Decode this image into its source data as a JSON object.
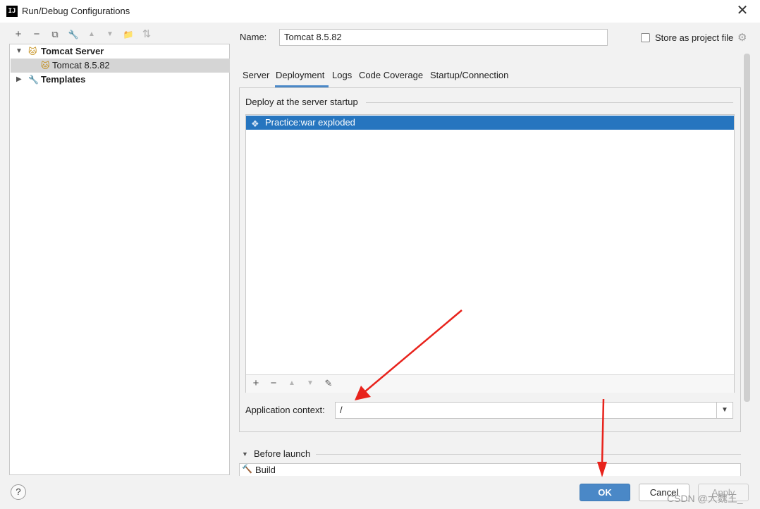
{
  "window": {
    "title": "Run/Debug Configurations",
    "app_icon_text": "IJ",
    "close_glyph": "✕"
  },
  "toolbar": {
    "add": "+",
    "remove": "−",
    "copy": "⧉",
    "edit_templates": "🔧",
    "move_up": "▲",
    "move_down": "▼",
    "new_folder": "📁",
    "sort": "⇅"
  },
  "tree": {
    "group_label": "Tomcat Server",
    "child_label": "Tomcat 8.5.82",
    "templates_label": "Templates"
  },
  "form": {
    "name_label": "Name:",
    "name_value": "Tomcat 8.5.82",
    "store_label": "Store as project file"
  },
  "tabs": [
    "Server",
    "Deployment",
    "Logs",
    "Code Coverage",
    "Startup/Connection"
  ],
  "active_tab": "Deployment",
  "deployment": {
    "section_title": "Deploy at the server startup",
    "items": [
      "Practice:war exploded"
    ],
    "context_label": "Application context:",
    "context_value": "/"
  },
  "before_launch": {
    "title": "Before launch",
    "items": [
      "Build"
    ]
  },
  "footer": {
    "help": "?",
    "ok": "OK",
    "cancel": "Cancel",
    "apply": "Apply"
  },
  "watermark": "CSDN @大魏王_",
  "colors": {
    "accent": "#4a88c7",
    "selection": "#2675bf",
    "annotation_arrow": "#e8231c"
  }
}
